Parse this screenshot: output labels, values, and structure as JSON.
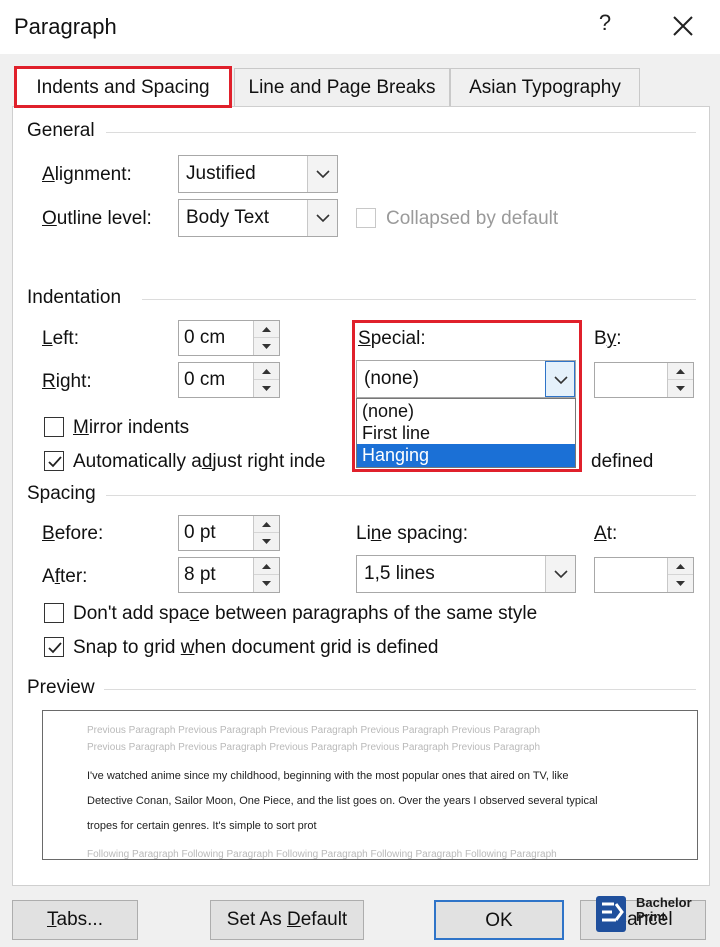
{
  "window": {
    "title": "Paragraph",
    "help": "?",
    "close_icon": "close-icon"
  },
  "tabs": [
    {
      "label": "Indents and Spacing",
      "active": true
    },
    {
      "label": "Line and Page Breaks",
      "active": false
    },
    {
      "label": "Asian Typography",
      "active": false
    }
  ],
  "general": {
    "title": "General",
    "alignment_label": "Alignment:",
    "alignment_value": "Justified",
    "outline_label": "Outline level:",
    "outline_value": "Body Text",
    "collapsed_label": "Collapsed by default"
  },
  "indentation": {
    "title": "Indentation",
    "left_label": "Left:",
    "left_value": "0 cm",
    "right_label": "Right:",
    "right_value": "0 cm",
    "special_label": "Special:",
    "special_value": "(none)",
    "special_options": [
      "(none)",
      "First line",
      "Hanging"
    ],
    "special_highlighted": "Hanging",
    "by_label": "By:",
    "by_value": "",
    "mirror_label": "Mirror indents",
    "mirror_checked": false,
    "auto_adjust_label_a": "Automatically adjust right inde",
    "auto_adjust_label_b": "defined",
    "auto_adjust_checked": true
  },
  "spacing": {
    "title": "Spacing",
    "before_label": "Before:",
    "before_value": "0 pt",
    "after_label": "After:",
    "after_value": "8 pt",
    "line_spacing_label": "Line spacing:",
    "line_spacing_value": "1,5 lines",
    "at_label": "At:",
    "at_value": "",
    "dont_add_label": "Don't add space between paragraphs of the same style",
    "dont_add_checked": false,
    "snap_label": "Snap to grid when document grid is defined",
    "snap_checked": true
  },
  "preview": {
    "title": "Preview",
    "prev_line1": "Previous Paragraph Previous Paragraph Previous Paragraph Previous Paragraph Previous Paragraph",
    "prev_line2": "Previous Paragraph Previous Paragraph Previous Paragraph Previous Paragraph Previous Paragraph",
    "text_line1": "I've watched anime since my childhood, beginning with the most popular ones that aired on TV, like",
    "text_line2": "Detective Conan, Sailor Moon, One Piece, and the list goes on. Over the years I observed several typical",
    "text_line3": "tropes for certain genres. It's simple to sort prot",
    "next_line1": "Following Paragraph Following Paragraph Following Paragraph Following Paragraph Following Paragraph"
  },
  "buttons": {
    "tabs": "Tabs...",
    "set_default": "Set As Default",
    "ok": "OK",
    "cancel": "Cancel"
  },
  "watermark": {
    "line1": "Bachelor",
    "line2": "Print"
  },
  "colors": {
    "highlight_red": "#e0202b",
    "selection_blue": "#1b70d6",
    "ok_border": "#2f74c8"
  }
}
